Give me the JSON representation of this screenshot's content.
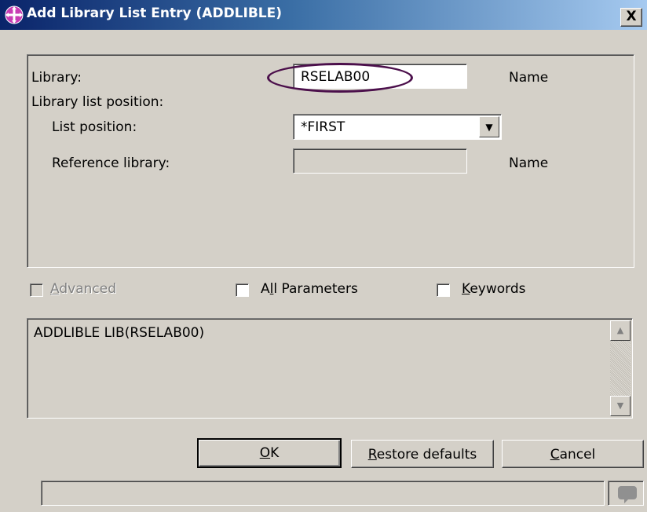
{
  "window": {
    "title": "Add Library List Entry (ADDLIBLE)",
    "close_label": "X"
  },
  "form": {
    "library_label": "Library:",
    "library_value": "RSELAB00",
    "library_hint": "Name",
    "position_group_label": "Library list position:",
    "list_position_label": "List position:",
    "list_position_value": "*FIRST",
    "reference_library_label": "Reference library:",
    "reference_library_value": "",
    "reference_library_hint": "Name"
  },
  "options": {
    "advanced": {
      "pre": "",
      "key": "A",
      "post": "dvanced",
      "checked": false,
      "enabled": false
    },
    "all_parameters": {
      "pre": "A",
      "key": "l",
      "post": "l Parameters",
      "checked": false,
      "enabled": true
    },
    "keywords": {
      "pre": "",
      "key": "K",
      "post": "eywords",
      "checked": false,
      "enabled": true
    }
  },
  "command_preview": "ADDLIBLE LIB(RSELAB00)",
  "buttons": {
    "ok": {
      "key": "O",
      "post": "K"
    },
    "restore": {
      "key": "R",
      "post": "estore defaults"
    },
    "cancel": {
      "key": "C",
      "post": "ancel"
    }
  },
  "status": {
    "text": "",
    "icon": "speech-bubble-icon"
  },
  "colors": {
    "title_gradient_start": "#0a246a",
    "title_gradient_end": "#a6caf0",
    "highlight_ellipse": "#4b0f4b",
    "dialog_bg": "#d4d0c8"
  }
}
